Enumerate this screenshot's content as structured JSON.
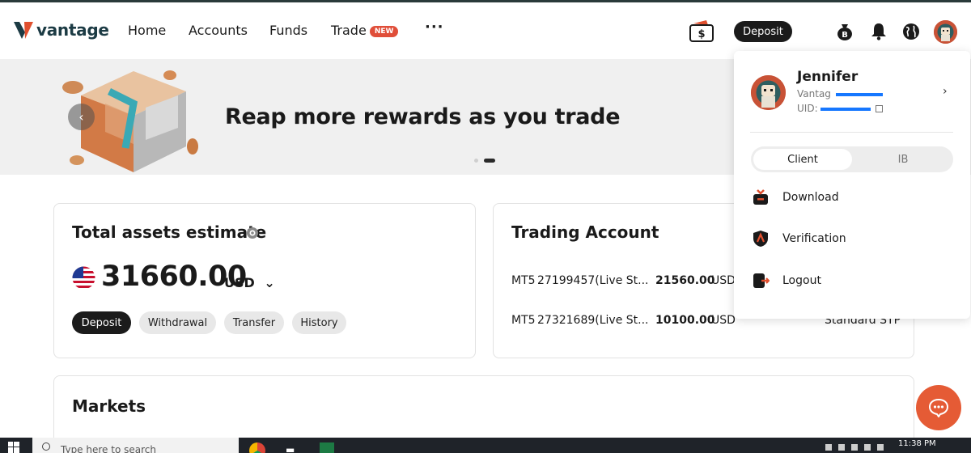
{
  "header": {
    "logo_text": "vantage",
    "nav": {
      "home": "Home",
      "accounts": "Accounts",
      "funds": "Funds",
      "trade": "Trade",
      "trade_badge": "NEW",
      "more": "···"
    },
    "deposit_label": "Deposit"
  },
  "banner": {
    "title": "Reap more rewards as you trade",
    "prev": "‹"
  },
  "assets_card": {
    "title": "Total assets estimate",
    "amount": "31660.00",
    "currency": "USD",
    "currency_arrow": "⌄",
    "buttons": {
      "deposit": "Deposit",
      "withdrawal": "Withdrawal",
      "transfer": "Transfer",
      "history": "History"
    }
  },
  "trading_card": {
    "title": "Trading Account",
    "accounts": [
      {
        "platform": "MT5",
        "number": "27199457(Live St...",
        "balance": "21560.00",
        "currency": "USD"
      },
      {
        "platform": "MT5",
        "number": "27321689(Live St...",
        "balance": "10100.00",
        "currency": "USD",
        "type": "Standard STP"
      }
    ]
  },
  "markets_card": {
    "title": "Markets"
  },
  "user_menu": {
    "name": "Jennifer",
    "sub1": "Vantag",
    "sub2": "UID:",
    "segments": {
      "client": "Client",
      "ib": "IB"
    },
    "items": {
      "download": "Download",
      "verification": "Verification",
      "logout": "Logout"
    }
  },
  "taskbar": {
    "search_placeholder": "Type here to search",
    "time": "11:38 PM"
  }
}
